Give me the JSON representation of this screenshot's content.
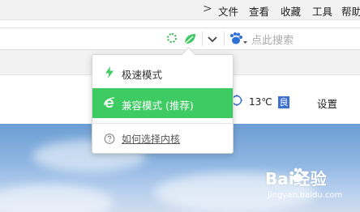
{
  "menubar": {
    "overflow_glyph": ">",
    "items": [
      "文件",
      "查看",
      "收藏",
      "工具",
      "帮助"
    ]
  },
  "addressbar": {
    "search_placeholder": "点此搜索"
  },
  "page": {
    "temperature": "13℃",
    "aqi_label": "良",
    "settings_label": "设置"
  },
  "dropdown": {
    "options": [
      {
        "label": "极速模式",
        "icon": "lightning-icon",
        "selected": false
      },
      {
        "label": "兼容模式 (推荐)",
        "icon": "ie-icon",
        "selected": true
      }
    ],
    "help_label": "如何选择内核"
  },
  "watermark": {
    "brand": "Bai经验",
    "url": "jingyan.baidu.com"
  },
  "colors": {
    "accent_green": "#3ecb63",
    "aqi_blue": "#3b6fd0"
  }
}
